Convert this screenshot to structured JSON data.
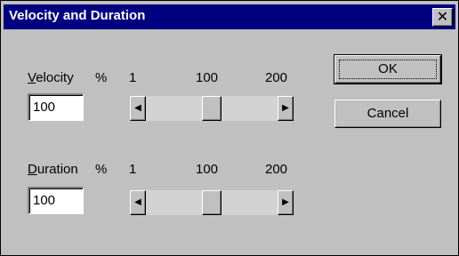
{
  "window": {
    "title": "Velocity and Duration",
    "close_glyph": "✕"
  },
  "velocity": {
    "label_access_key": "V",
    "label_rest": "elocity",
    "unit": "%",
    "scale_min": "1",
    "scale_mid": "100",
    "scale_max": "200",
    "value": "100",
    "slider": {
      "min": 1,
      "max": 200,
      "value": 100
    }
  },
  "duration": {
    "label_access_key": "D",
    "label_rest": "uration",
    "unit": "%",
    "scale_min": "1",
    "scale_mid": "100",
    "scale_max": "200",
    "value": "100",
    "slider": {
      "min": 1,
      "max": 200,
      "value": 100
    }
  },
  "buttons": {
    "ok_label": "OK",
    "cancel_label": "Cancel"
  },
  "icons": {
    "close": "close-icon",
    "arrow_left": "arrow-left-icon",
    "arrow_right": "arrow-right-icon"
  },
  "colors": {
    "titlebar": "#000080",
    "face": "#c0c0c0",
    "title_text": "#ffffff"
  }
}
